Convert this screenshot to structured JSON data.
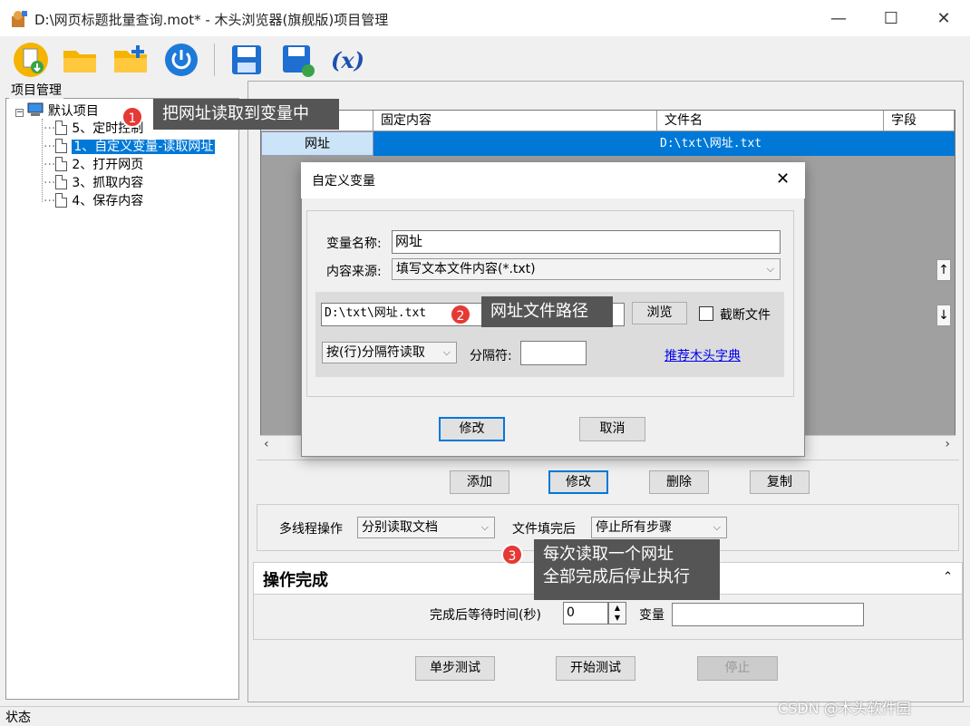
{
  "window": {
    "title": "D:\\网页标题批量查询.mot* - 木头浏览器(旗舰版)项目管理",
    "min": "—",
    "max": "☐",
    "close": "✕"
  },
  "left_panel": {
    "title": "项目管理",
    "tree": {
      "root": "默认项目",
      "items": [
        "5、定时控制",
        "1、自定义变量-读取网址",
        "2、打开网页",
        "3、抓取内容",
        "4、保存内容"
      ]
    }
  },
  "grid": {
    "headers": [
      "固定内容",
      "文件名",
      "字段"
    ],
    "row": {
      "name": "网址",
      "fixed": "",
      "file": "D:\\txt\\网址.txt",
      "field": ""
    }
  },
  "actions": {
    "add": "添加",
    "modify": "修改",
    "delete": "删除",
    "copy": "复制"
  },
  "multithread": {
    "label": "多线程操作",
    "value": "分别读取文档",
    "after_label": "文件填完后",
    "after_value": "停止所有步骤"
  },
  "complete": {
    "title": "操作完成",
    "wait_label": "完成后等待时间(秒)",
    "wait_value": "0",
    "var_label": "变量",
    "var_value": ""
  },
  "bottom": {
    "step": "单步测试",
    "start": "开始测试",
    "stop": "停止"
  },
  "status": "状态",
  "watermark": "CSDN @木头软件园",
  "dialog": {
    "title": "自定义变量",
    "close": "✕",
    "name_label": "变量名称:",
    "name_value": "网址",
    "source_label": "内容来源:",
    "source_value": "填写文本文件内容(*.txt)",
    "path_value": "D:\\txt\\网址.txt",
    "browse": "浏览",
    "truncate_label": "截断文件",
    "read_mode": "按(行)分隔符读取",
    "sep_label": "分隔符:",
    "sep_value": "",
    "link": "推荐木头字典",
    "ok": "修改",
    "cancel": "取消"
  },
  "annotations": [
    {
      "n": "1",
      "text": "把网址读取到变量中"
    },
    {
      "n": "2",
      "text": "网址文件路径"
    },
    {
      "n": "3",
      "line1": "每次读取一个网址",
      "line2": "全部完成后停止执行"
    }
  ],
  "colors": {
    "selection": "#0078d7",
    "tip_bg": "#555555",
    "badge": "#e53935",
    "link": "#0000ee"
  }
}
